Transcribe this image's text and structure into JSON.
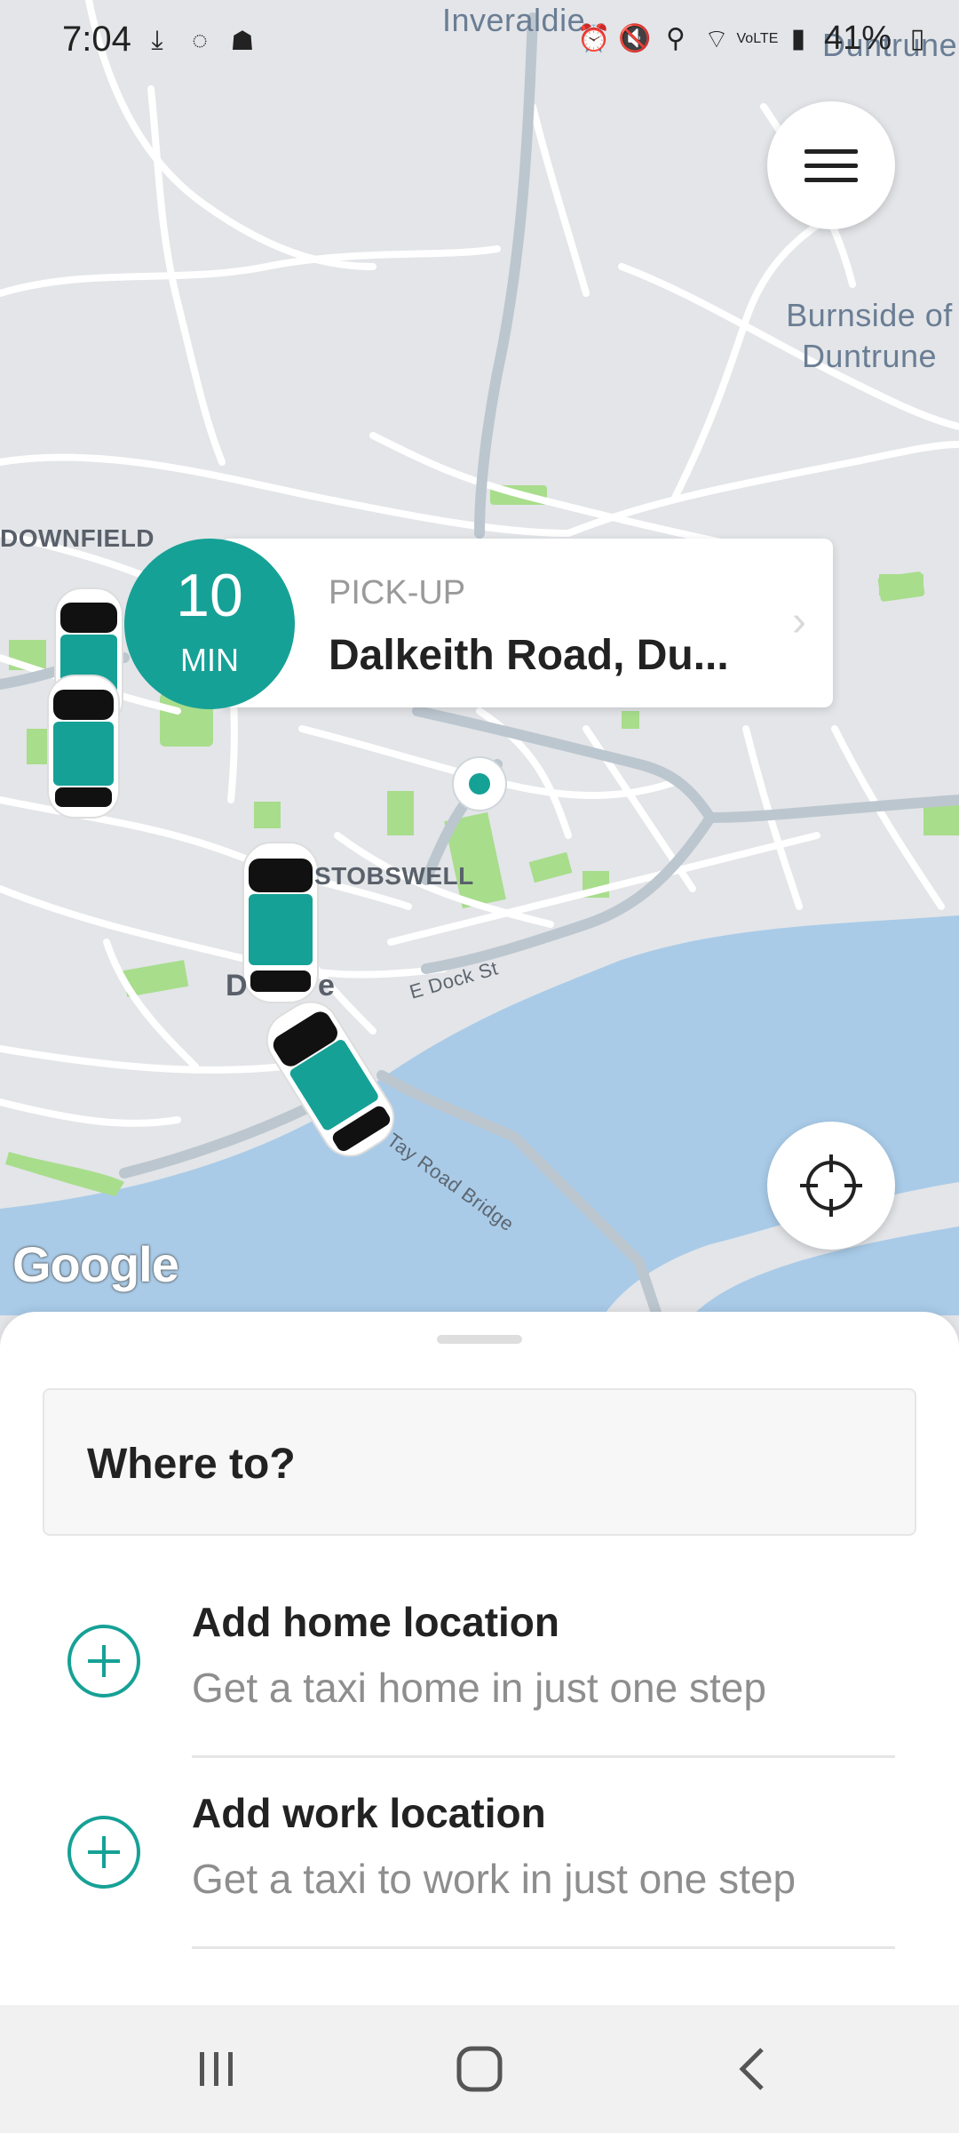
{
  "status_bar": {
    "time": "7:04",
    "battery": "41%",
    "left_icons": [
      "download-icon",
      "whatsapp-icon",
      "snapchat-icon"
    ],
    "right_icons": [
      "alarm-icon",
      "mute-icon",
      "location-icon",
      "wifi-icon",
      "volte-icon",
      "signal-icon",
      "battery-icon"
    ]
  },
  "map": {
    "labels": {
      "inveraldie": "Inveraldie",
      "duntrune": "Duntrune",
      "burnside": "Burnside of Duntrune",
      "downfield": "DOWNFIELD",
      "stobswell": "STOBSWELL",
      "dundee_partial": "D",
      "dundee_partial2": "e",
      "dock_st": "E Dock St",
      "tay_bridge": "Tay Road Bridge"
    },
    "attribution": "Google",
    "water_color": "#a9cbe8",
    "land_color": "#e3e5e8",
    "park_color": "#a8dd8c"
  },
  "pickup": {
    "eta_value": "10",
    "eta_unit": "MIN",
    "title": "PICK-UP",
    "address": "Dalkeith Road, Du...",
    "accent": "#16a196"
  },
  "sheet": {
    "search_placeholder": "Where to?",
    "locations": [
      {
        "title": "Add home location",
        "subtitle": "Get a taxi home in just one step"
      },
      {
        "title": "Add work location",
        "subtitle": "Get a taxi to work in just one step"
      }
    ]
  }
}
